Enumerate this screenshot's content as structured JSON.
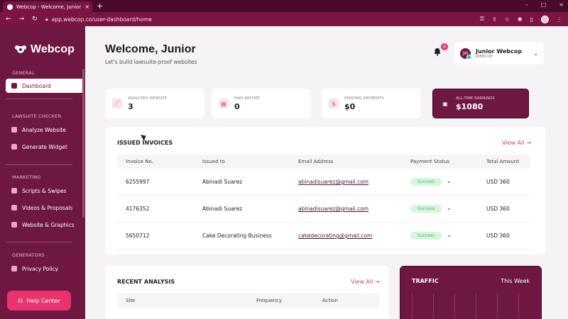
{
  "browser": {
    "tab_title": "Webcop - Welcome, Junior",
    "url": "app.webcop.co/user-dashboard/home"
  },
  "sidebar": {
    "brand": "Webcop",
    "sections": [
      {
        "label": "GENERAL",
        "items": [
          {
            "label": "Dashboard",
            "active": true,
            "icon": "dashboard-icon"
          }
        ]
      },
      {
        "label": "LAWSUITE CHECKER",
        "items": [
          {
            "label": "Analyze Website",
            "icon": "analyze-icon"
          },
          {
            "label": "Generate Widget",
            "icon": "widget-icon"
          }
        ]
      },
      {
        "label": "MARKETING",
        "items": [
          {
            "label": "Scripts & Swipes",
            "icon": "scripts-icon"
          },
          {
            "label": "Videos & Proposals",
            "icon": "video-icon"
          },
          {
            "label": "Website & Graphics",
            "icon": "graphics-icon"
          }
        ]
      },
      {
        "label": "GENERATORS",
        "items": [
          {
            "label": "Privacy Policy",
            "icon": "privacy-icon"
          }
        ]
      }
    ],
    "help_label": "Help Center"
  },
  "header": {
    "welcome": "Welcome, Junior",
    "subtitle": "Let's build lawsuite-proof websites",
    "notification_count": "0",
    "user_initials": "JW",
    "user_name": "Junior Webcop",
    "user_role": "WEBCOP"
  },
  "stats": [
    {
      "label": "ANALYZED WEBSITE",
      "value": "3",
      "icon": "chart-icon"
    },
    {
      "label": "PAID REPORT",
      "value": "0",
      "icon": "report-icon"
    },
    {
      "label": "PENDING PAYMENTS",
      "value": "$0",
      "icon": "dollar-icon"
    },
    {
      "label": "ALL-TIME EARNINGS",
      "value": "$1080",
      "icon": "wallet-icon"
    }
  ],
  "invoices": {
    "title": "ISSUED INVOICES",
    "view_all": "View All →",
    "columns": [
      "Invoice No.",
      "Issued to",
      "Email Address",
      "Payment Status",
      "Total Amount"
    ],
    "rows": [
      {
        "no": "6255997",
        "to": "Abinadi Suarez",
        "email": "abinadisuarez@gmail.com",
        "status": "Success",
        "amount": "USD 360"
      },
      {
        "no": "4176352",
        "to": "Abinadi Suarez",
        "email": "abinadisuarez@gmail.com",
        "status": "Success",
        "amount": "USD 360"
      },
      {
        "no": "5650712",
        "to": "Cake Decorating Business",
        "email": "cakedecorating@gmail.com",
        "status": "Success",
        "amount": "USD 360"
      }
    ]
  },
  "recent": {
    "title": "RECENT ANALYSIS",
    "view_all": "View All →",
    "columns": [
      "Site",
      "Frequency",
      "Action"
    ]
  },
  "traffic": {
    "title": "TRAFFIC",
    "period": "This Week"
  }
}
